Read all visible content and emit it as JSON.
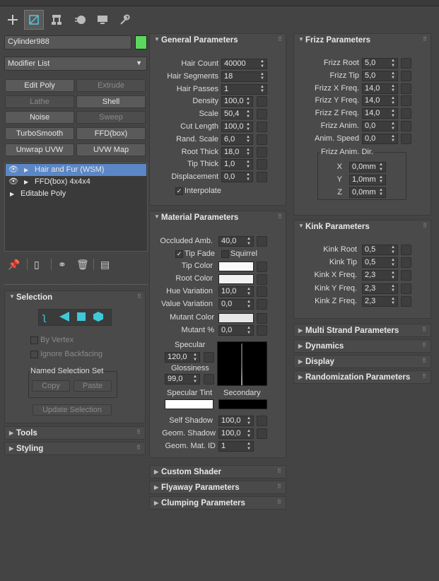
{
  "toolbar": {
    "tabs": [
      "create-icon",
      "modify-icon",
      "hierarchy-icon",
      "motion-icon",
      "display-icon",
      "utilities-icon"
    ]
  },
  "object": {
    "name": "Cylinder988",
    "color": "#5cd65c"
  },
  "modifier_list": {
    "label": "Modifier List"
  },
  "modifier_buttons": [
    {
      "label": "Edit Poly",
      "enabled": true
    },
    {
      "label": "Extrude",
      "enabled": false
    },
    {
      "label": "Lathe",
      "enabled": false
    },
    {
      "label": "Shell",
      "enabled": true
    },
    {
      "label": "Noise",
      "enabled": true
    },
    {
      "label": "Sweep",
      "enabled": false
    },
    {
      "label": "TurboSmooth",
      "enabled": true
    },
    {
      "label": "FFD(box)",
      "enabled": true
    },
    {
      "label": "Unwrap UVW",
      "enabled": true
    },
    {
      "label": "UVW Map",
      "enabled": true
    }
  ],
  "stack": [
    {
      "label": "Hair and Fur (WSM)",
      "selected": true
    },
    {
      "label": "FFD(box) 4x4x4",
      "selected": false
    },
    {
      "label": "Editable Poly",
      "selected": false
    }
  ],
  "selection": {
    "title": "Selection",
    "by_vertex": "By Vertex",
    "ignore_backfacing": "Ignore Backfacing",
    "named_set": "Named Selection Set",
    "copy": "Copy",
    "paste": "Paste",
    "update": "Update Selection"
  },
  "tools": {
    "title": "Tools"
  },
  "styling": {
    "title": "Styling"
  },
  "general": {
    "title": "General Parameters",
    "rows": [
      {
        "label": "Hair Count",
        "value": "40000"
      },
      {
        "label": "Hair Segments",
        "value": "18"
      },
      {
        "label": "Hair Passes",
        "value": "1"
      },
      {
        "label": "Density",
        "value": "100,0"
      },
      {
        "label": "Scale",
        "value": "50,4"
      },
      {
        "label": "Cut Length",
        "value": "100,0"
      },
      {
        "label": "Rand. Scale",
        "value": "6,0"
      },
      {
        "label": "Root Thick",
        "value": "18,0"
      },
      {
        "label": "Tip Thick",
        "value": "1,0"
      },
      {
        "label": "Displacement",
        "value": "0,0"
      }
    ],
    "interpolate": "Interpolate"
  },
  "material": {
    "title": "Material Parameters",
    "occluded_label": "Occluded Amb.",
    "occluded_value": "40,0",
    "tip_fade": "Tip Fade",
    "squirrel": "Squirrel",
    "tip_color": "Tip Color",
    "root_color": "Root Color",
    "hue_variation": "Hue Variation",
    "hue_value": "10,0",
    "value_variation": "Value Variation",
    "value_value": "0,0",
    "mutant_color": "Mutant Color",
    "mutant_pct": "Mutant %",
    "mutant_value": "0,0",
    "specular": "Specular",
    "specular_value": "120,0",
    "glossiness": "Glossiness",
    "glossiness_value": "99,0",
    "specular_tint": "Specular Tint",
    "secondary": "Secondary",
    "self_shadow": "Self Shadow",
    "self_shadow_value": "100,0",
    "geom_shadow": "Geom. Shadow",
    "geom_shadow_value": "100,0",
    "geom_mat_id": "Geom. Mat. ID",
    "geom_mat_id_value": "1"
  },
  "collapsed_mid": [
    "Custom Shader",
    "Flyaway Parameters",
    "Clumping Parameters"
  ],
  "frizz": {
    "title": "Frizz Parameters",
    "rows": [
      {
        "label": "Frizz Root",
        "value": "5,0"
      },
      {
        "label": "Frizz Tip",
        "value": "5,0"
      },
      {
        "label": "Frizz X Freq.",
        "value": "14,0"
      },
      {
        "label": "Frizz Y Freq.",
        "value": "14,0"
      },
      {
        "label": "Frizz Z Freq.",
        "value": "14,0"
      },
      {
        "label": "Frizz Anim.",
        "value": "0,0"
      },
      {
        "label": "Anim. Speed",
        "value": "0,0"
      }
    ],
    "dir_group": "Frizz Anim. Dir.",
    "dir": [
      {
        "label": "X",
        "value": "0,0mm"
      },
      {
        "label": "Y",
        "value": "1,0mm"
      },
      {
        "label": "Z",
        "value": "0,0mm"
      }
    ]
  },
  "kink": {
    "title": "Kink Parameters",
    "rows": [
      {
        "label": "Kink Root",
        "value": "0,5"
      },
      {
        "label": "Kink Tip",
        "value": "0,5"
      },
      {
        "label": "Kink X Freq.",
        "value": "2,3"
      },
      {
        "label": "Kink Y Freq.",
        "value": "2,3"
      },
      {
        "label": "Kink Z Freq.",
        "value": "2,3"
      }
    ]
  },
  "collapsed_right": [
    "Multi Strand Parameters",
    "Dynamics",
    "Display",
    "Randomization Parameters"
  ]
}
